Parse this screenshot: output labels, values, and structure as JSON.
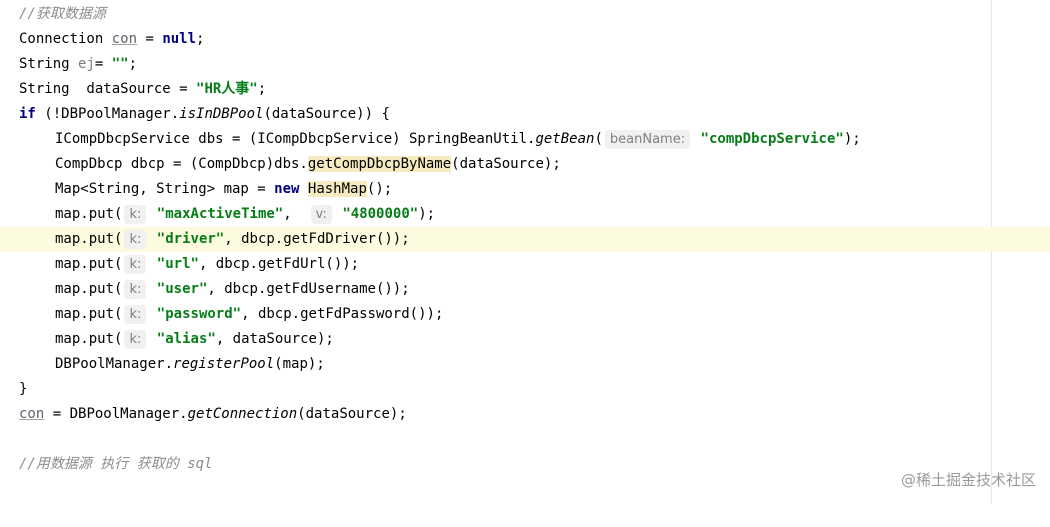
{
  "lines": [
    {
      "parts": [
        "//获取数据源"
      ]
    },
    {
      "parts": [
        "Connection ",
        "con",
        " = ",
        "null",
        ";"
      ]
    },
    {
      "parts": [
        "String ",
        "ej",
        "= ",
        "\"\"",
        ";"
      ]
    },
    {
      "parts": [
        "String  dataSource = ",
        "\"HR人事\"",
        ";"
      ]
    },
    {
      "parts": [
        "if",
        " (!DBPoolManager.",
        "isInDBPool",
        "(dataSource)) {"
      ]
    },
    {
      "parts": [
        "ICompDbcpService dbs = (ICompDbcpService) SpringBeanUtil.",
        "getBean",
        "(",
        "beanName:",
        " ",
        "\"compDbcpService\"",
        ");"
      ]
    },
    {
      "parts": [
        "CompDbcp dbcp = (CompDbcp)dbs.",
        "getCompDbcpByName",
        "(dataSource);"
      ]
    },
    {
      "parts": [
        "Map<String, String> map = ",
        "new",
        " ",
        "HashMap",
        "();"
      ]
    },
    {
      "parts": [
        "map.put(",
        "k:",
        " ",
        "\"maxActiveTime\"",
        ",  ",
        "v:",
        " ",
        "\"4800000\"",
        ");"
      ]
    },
    {
      "parts": [
        "map.put(",
        "k:",
        " ",
        "\"driver\"",
        ", dbcp.getFdDriver());"
      ]
    },
    {
      "parts": [
        "map.put(",
        "k:",
        " ",
        "\"url\"",
        ", dbcp.getFdUrl());"
      ]
    },
    {
      "parts": [
        "map.put(",
        "k:",
        " ",
        "\"user\"",
        ", dbcp.getFdUsername());"
      ]
    },
    {
      "parts": [
        "map.put(",
        "k:",
        " ",
        "\"password\"",
        ", dbcp.getFdPassword());"
      ]
    },
    {
      "parts": [
        "map.put(",
        "k:",
        " ",
        "\"alias\"",
        ", dataSource);"
      ]
    },
    {
      "parts": [
        "DBPoolManager.",
        "registerPool",
        "(map);"
      ]
    },
    {
      "parts": [
        "}"
      ]
    },
    {
      "parts": [
        "con",
        " = DBPoolManager.",
        "getConnection",
        "(dataSource);"
      ]
    },
    {
      "parts": [
        "//用数据源 执行 获取的 sql"
      ]
    }
  ],
  "watermark": "@稀土掘金技术社区",
  "colors": {
    "keyword": "#000080",
    "string": "#067d17",
    "comment": "#8c8c8c",
    "current_line": "#fcfadf",
    "usage_highlight": "#f5eac0"
  }
}
